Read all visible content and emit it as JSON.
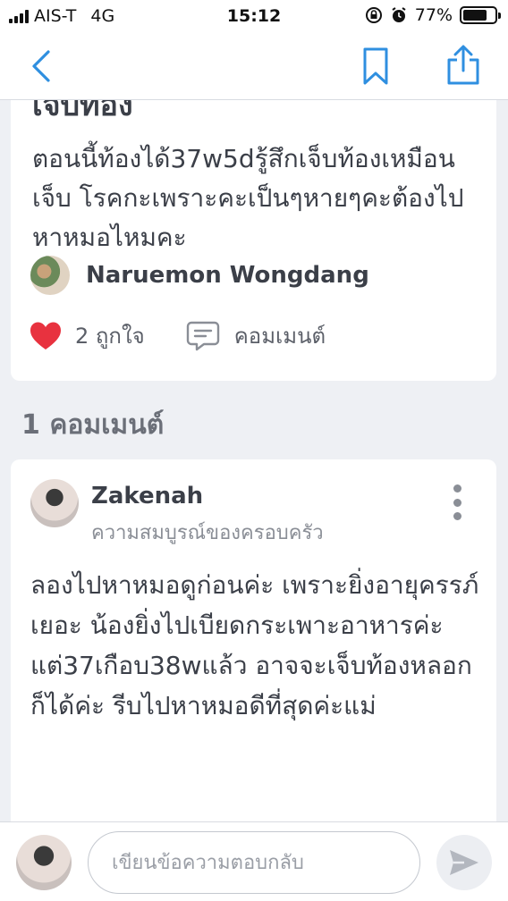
{
  "status_bar": {
    "carrier": "AIS-T",
    "network": "4G",
    "time": "15:12",
    "battery": "77%",
    "battery_level": 0.77
  },
  "nav": {
    "back_icon": "chevron-left-icon",
    "bookmark_icon": "bookmark-icon",
    "share_icon": "share-icon",
    "accent_color": "#2f8fe0"
  },
  "post": {
    "title_tail": "เจ็บท้อง",
    "body": "ตอนนี้ท้องได้37w5dรู้สึกเจ็บท้องเหมือนเจ็บ โรคกะเพราะคะเป็นๆหายๆคะต้องไปหาหมอไหมคะ",
    "author": "Naruemon Wongdang",
    "like_label": "2 ถูกใจ",
    "comment_label": "คอมเมนต์",
    "like_color": "#e8323f"
  },
  "comments_header": "1 คอมเมนต์",
  "comment": {
    "user": "Zakenah",
    "subtitle": "ความสมบูรณ์ของครอบครัว",
    "body": "ลองไปหาหมอดูก่อนค่ะ เพราะยิ่งอายุครรภ์เยอะ น้องยิ่งไปเบียดกระเพาะอาหารค่ะ แต่37เกือบ38wแล้ว  อาจจะเจ็บท้องหลอกก็ได้ค่ะ รีบไปหาหมอดีที่สุดค่ะแม่"
  },
  "reply": {
    "placeholder": "เขียนข้อความตอบกลับ",
    "send_icon": "send-icon"
  }
}
